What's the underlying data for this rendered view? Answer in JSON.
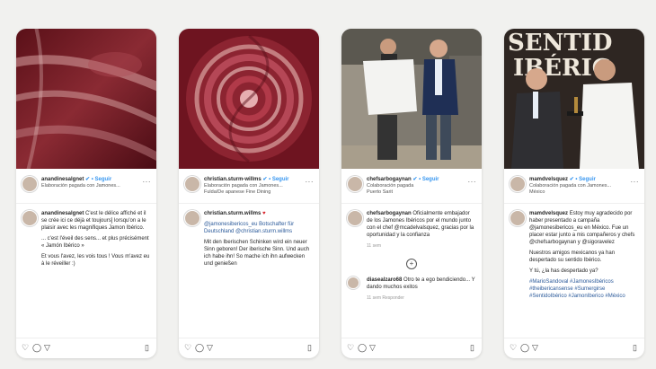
{
  "posts": [
    {
      "username": "anandinesalgnet",
      "verified": "✔",
      "follow": "• Seguir",
      "subline": "Elaboración pagada con Jamones...",
      "more": "···",
      "comment_user": "anandinesalgnet",
      "comment_paragraphs": [
        "C'est le délice affiché et il se crée ici ce déjà et toujours] lorsqu'on a le plaisir avec les magnifiques Jamon Ibérico.",
        "... c'est l'éveil des sens... et plus précisément « Jamón Ibérico »",
        "Et vous l'avez, les vois tous ! Vous m'avez eu à le réveiller :)"
      ]
    },
    {
      "username": "christian.sturm-willms",
      "verified": "✔",
      "follow": "• Seguir",
      "subline": "Elaboración pagada con Jamones...",
      "subline2": "Fulda/De apanese Fine Dining",
      "more": "···",
      "comment_user": "christian.sturm.willms",
      "comment_paragraphs": [
        "@jamonesibericos_eu Botschafter für Deutschland @christian.sturm.willms",
        "Mit den Iberischen Schinken wird ein neuer Sinn geboren! Der iberische Sinn. Und auch ich habe ihn! So mache ich ihn aufwecken und genießen"
      ]
    },
    {
      "username": "chefsarbogaynan",
      "verified": "✔",
      "follow": "• Seguir",
      "subline": "Colaboración pagada",
      "subline2": "Puerto Sarit",
      "more": "···",
      "comment_user": "chefsarbogaynan",
      "comment_paragraphs": [
        "Oficialmente embajador de los Jamones Ibéricos por el mundo junto con el chef @mcadelvalsquez, gracias por la oportunidad y la confianza"
      ],
      "comment_time": "11 sem",
      "plus": "+",
      "reply_user": "diasealzaro68",
      "reply_text": "Otro te a ego bendiciendo... Y dando muchos exitos",
      "reply_meta": "11 sem   Responder"
    },
    {
      "username": "mamdvelsquez",
      "verified": "✔",
      "follow": "• Seguir",
      "subline": "Colaboración pagada con Jamones...",
      "subline2": "México",
      "more": "···",
      "comment_user": "mamdvelsquez",
      "comment_paragraphs": [
        "Estoy muy agradecido por haber presentado a campaña @jamonesibericos_eu en México. Fue un placer estar junto a mis compañeros y chefs @chefsarbogaynan y @sigoravelez",
        "Nuestros amigos mexicanos ya han despertado su sentido Ibérico.",
        "Y tú, ¿la has despertado ya?",
        "#MarioSandoval #JamonesIbéricos #theibericansense #Sumergirse #SentidoIbérico #JamonIberico #México"
      ]
    }
  ],
  "photo_text_card4": [
    "SENTID",
    "IBÉRIC"
  ],
  "icons": [
    "heart-icon",
    "comment-icon",
    "share-icon",
    "bookmark-icon"
  ],
  "icon_glyphs": {
    "heart": "♡",
    "comment": "◯",
    "share": "▽",
    "save": "▯"
  },
  "colors": {
    "link": "#3897f0",
    "background": "#f1f1ef"
  }
}
